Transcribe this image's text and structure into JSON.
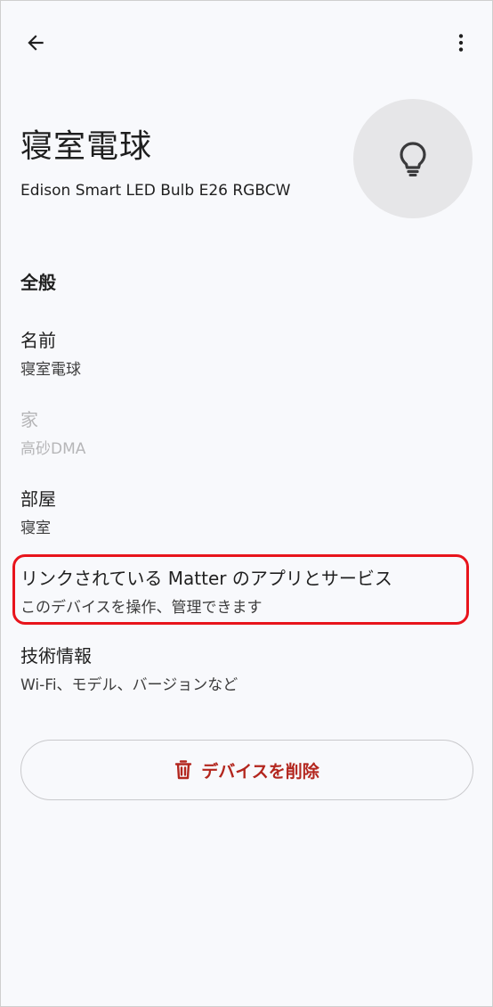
{
  "header": {
    "back_icon": "arrow-back-icon",
    "more_icon": "more-vert-icon"
  },
  "device": {
    "name": "寝室電球",
    "model": "Edison Smart LED Bulb E26 RGBCW",
    "avatar_icon": "lightbulb-icon"
  },
  "general": {
    "heading": "全般",
    "name_label": "名前",
    "name_value": "寝室電球",
    "home_label": "家",
    "home_value": "高砂DMA",
    "room_label": "部屋",
    "room_value": "寝室",
    "matter_label": "リンクされている Matter のアプリとサービス",
    "matter_value": "このデバイスを操作、管理できます",
    "tech_label": "技術情報",
    "tech_value": "Wi-Fi、モデル、バージョンなど"
  },
  "actions": {
    "delete_label": "デバイスを削除",
    "delete_icon": "trash-icon"
  },
  "colors": {
    "background": "#f8f9fc",
    "text_primary": "#1f1f1f",
    "text_disabled": "#b6b6b8",
    "danger": "#b3261e",
    "highlight": "#e8141c",
    "avatar_bg": "#e6e6e8"
  }
}
